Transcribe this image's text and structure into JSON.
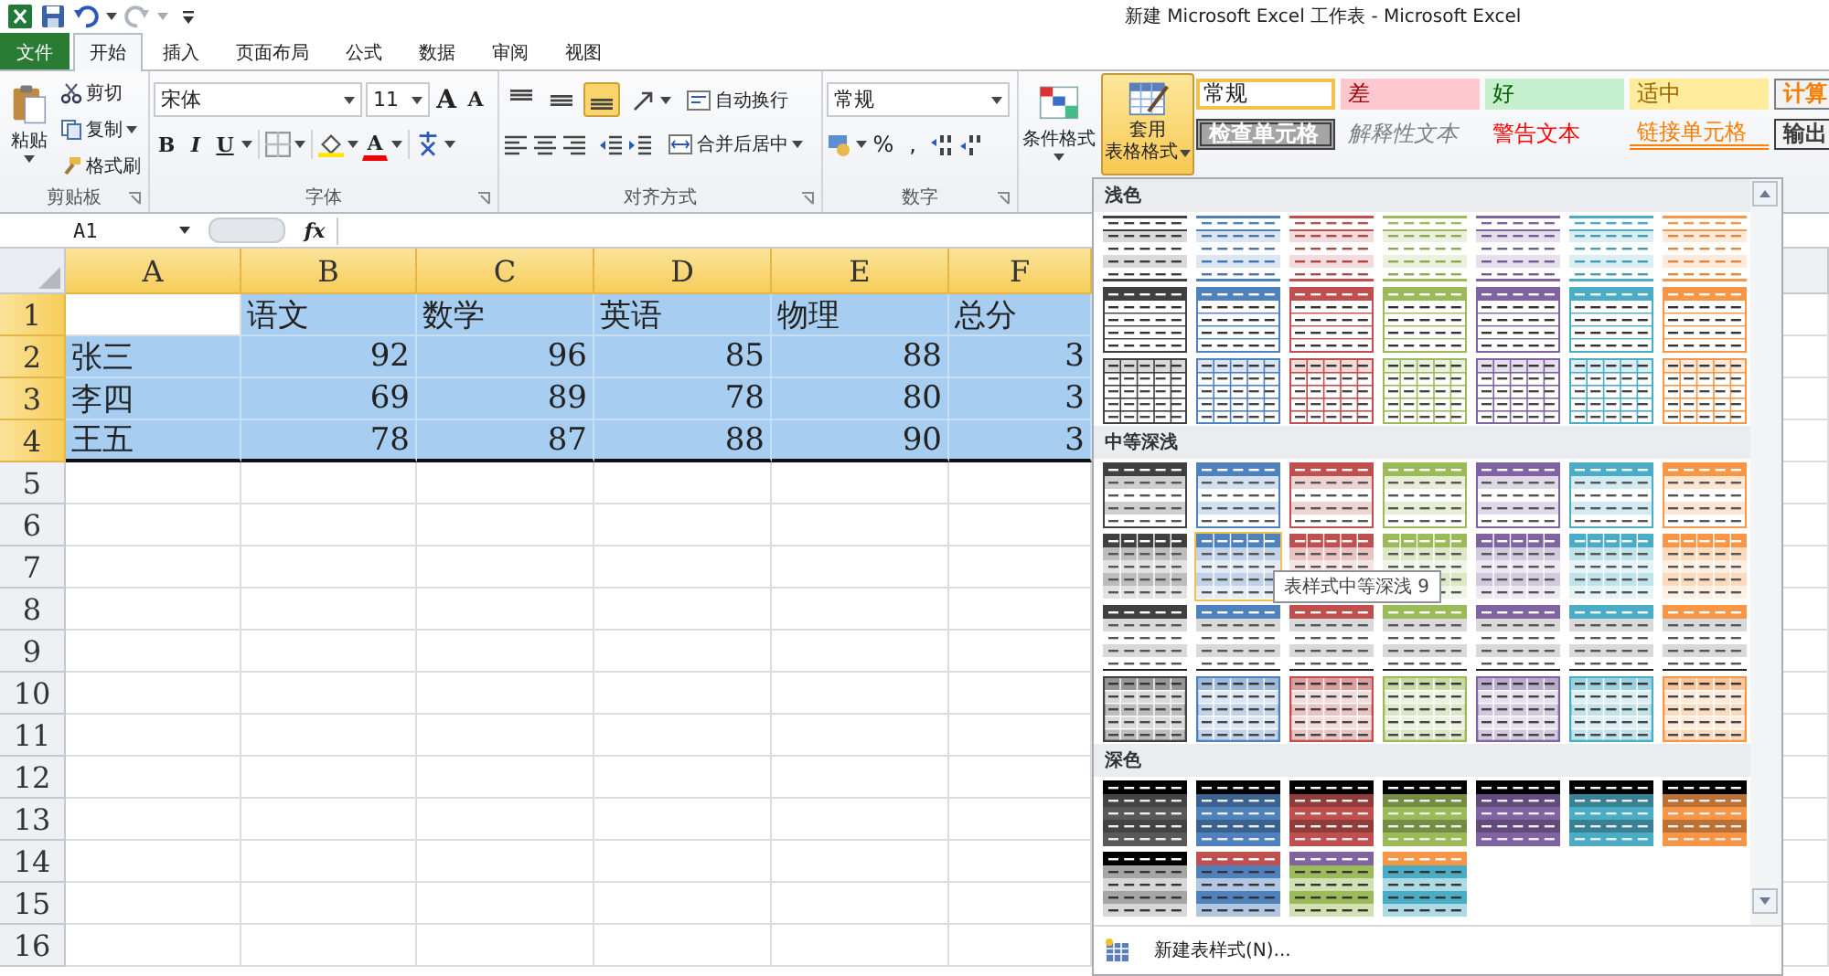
{
  "title_bar": {
    "title": "新建 Microsoft Excel 工作表 - Microsoft Excel"
  },
  "tabs": [
    {
      "label": "文件",
      "kind": "file",
      "selected": false
    },
    {
      "label": "开始",
      "kind": "tab",
      "selected": true
    },
    {
      "label": "插入",
      "kind": "tab",
      "selected": false
    },
    {
      "label": "页面布局",
      "kind": "tab",
      "selected": false
    },
    {
      "label": "公式",
      "kind": "tab",
      "selected": false
    },
    {
      "label": "数据",
      "kind": "tab",
      "selected": false
    },
    {
      "label": "审阅",
      "kind": "tab",
      "selected": false
    },
    {
      "label": "视图",
      "kind": "tab",
      "selected": false
    }
  ],
  "ribbon": {
    "clipboard": {
      "label": "剪贴板",
      "paste": "粘贴",
      "cut": "剪切",
      "copy": "复制",
      "painter": "格式刷"
    },
    "font": {
      "label": "字体",
      "font_name": "宋体",
      "font_size": "11",
      "grow": "A",
      "shrink": "A",
      "bold": "B",
      "italic": "I",
      "underline": "U",
      "color_letter": "A"
    },
    "alignment": {
      "label": "对齐方式",
      "wrap": "自动换行",
      "merge": "合并后居中",
      "vertical": [
        {
          "kind": "top",
          "selected": false
        },
        {
          "kind": "middle",
          "selected": false
        },
        {
          "kind": "bottom",
          "selected": true
        }
      ]
    },
    "number": {
      "label": "数字",
      "format": "常规",
      "percent": "%",
      "comma": ","
    },
    "conditional_format": "条件格式",
    "format_as_table": {
      "line1": "套用",
      "line2": "表格格式",
      "selected": true
    },
    "cell_styles": [
      {
        "label": "常规",
        "kind": "normal",
        "selected": true
      },
      {
        "label": "差",
        "kind": "bad",
        "selected": false
      },
      {
        "label": "好",
        "kind": "good",
        "selected": false
      },
      {
        "label": "适中",
        "kind": "neutral",
        "selected": false
      },
      {
        "label": "计算",
        "kind": "calculation",
        "selected": false
      },
      {
        "label": "检查单元格",
        "kind": "check",
        "selected": false
      },
      {
        "label": "解释性文本",
        "kind": "explanatory",
        "selected": false
      },
      {
        "label": "警告文本",
        "kind": "warning",
        "selected": false
      },
      {
        "label": "链接单元格",
        "kind": "linked",
        "selected": false
      },
      {
        "label": "输出",
        "kind": "output",
        "selected": false
      }
    ]
  },
  "formula_bar": {
    "name_box": "A1",
    "fx": "fx"
  },
  "sheet": {
    "columns": [
      {
        "label": "A",
        "selected": true
      },
      {
        "label": "B",
        "selected": true
      },
      {
        "label": "C",
        "selected": true
      },
      {
        "label": "D",
        "selected": true
      },
      {
        "label": "E",
        "selected": true
      },
      {
        "label": "F",
        "selected": true
      }
    ],
    "rows": [
      {
        "number": "1",
        "selected": true,
        "cells": [
          null,
          "语文",
          "数学",
          "英语",
          "物理",
          "总分"
        ]
      },
      {
        "number": "2",
        "selected": true,
        "cells": [
          "张三",
          "92",
          "96",
          "85",
          "88",
          "3"
        ]
      },
      {
        "number": "3",
        "selected": true,
        "cells": [
          "李四",
          "69",
          "89",
          "78",
          "80",
          "3"
        ]
      },
      {
        "number": "4",
        "selected": true,
        "cells": [
          "王五",
          "78",
          "87",
          "88",
          "90",
          "3"
        ]
      },
      {
        "number": "5",
        "selected": false
      },
      {
        "number": "6",
        "selected": false
      },
      {
        "number": "7",
        "selected": false
      },
      {
        "number": "8",
        "selected": false
      },
      {
        "number": "9",
        "selected": false
      },
      {
        "number": "10",
        "selected": false
      },
      {
        "number": "11",
        "selected": false
      },
      {
        "number": "12",
        "selected": false
      },
      {
        "number": "13",
        "selected": false
      },
      {
        "number": "14",
        "selected": false
      },
      {
        "number": "15",
        "selected": false
      },
      {
        "number": "16",
        "selected": false
      }
    ]
  },
  "gallery": {
    "sections": [
      {
        "title": "浅色",
        "rows": [
          {
            "kind": "light-banded",
            "styles": [
              {
                "color": "#404040",
                "selected": false
              },
              {
                "color": "#4f81bd",
                "selected": false
              },
              {
                "color": "#c0504d",
                "selected": false
              },
              {
                "color": "#9bbb59",
                "selected": false
              },
              {
                "color": "#8064a2",
                "selected": false
              },
              {
                "color": "#4bacc6",
                "selected": false
              },
              {
                "color": "#f79646",
                "selected": false
              }
            ]
          },
          {
            "kind": "light-header",
            "styles": [
              {
                "color": "#404040",
                "selected": false
              },
              {
                "color": "#4f81bd",
                "selected": false
              },
              {
                "color": "#c0504d",
                "selected": false
              },
              {
                "color": "#9bbb59",
                "selected": false
              },
              {
                "color": "#8064a2",
                "selected": false
              },
              {
                "color": "#4bacc6",
                "selected": false
              },
              {
                "color": "#f79646",
                "selected": false
              }
            ]
          },
          {
            "kind": "light-grid",
            "styles": [
              {
                "color": "#404040",
                "selected": false
              },
              {
                "color": "#4f81bd",
                "selected": false
              },
              {
                "color": "#c0504d",
                "selected": false
              },
              {
                "color": "#9bbb59",
                "selected": false
              },
              {
                "color": "#8064a2",
                "selected": false
              },
              {
                "color": "#4bacc6",
                "selected": false
              },
              {
                "color": "#f79646",
                "selected": false
              }
            ]
          }
        ]
      },
      {
        "title": "中等深浅",
        "rows": [
          {
            "kind": "medium-banded",
            "styles": [
              {
                "color": "#404040",
                "selected": false
              },
              {
                "color": "#4f81bd",
                "selected": false
              },
              {
                "color": "#c0504d",
                "selected": false
              },
              {
                "color": "#9bbb59",
                "selected": false
              },
              {
                "color": "#8064a2",
                "selected": false
              },
              {
                "color": "#4bacc6",
                "selected": false
              },
              {
                "color": "#f79646",
                "selected": false
              }
            ]
          },
          {
            "kind": "medium-header-grid",
            "styles": [
              {
                "color": "#404040",
                "selected": false
              },
              {
                "color": "#4f81bd",
                "selected": true
              },
              {
                "color": "#c0504d",
                "selected": false
              },
              {
                "color": "#9bbb59",
                "selected": false
              },
              {
                "color": "#8064a2",
                "selected": false
              },
              {
                "color": "#4bacc6",
                "selected": false
              },
              {
                "color": "#f79646",
                "selected": false
              }
            ]
          },
          {
            "kind": "medium-plain",
            "styles": [
              {
                "color": "#404040",
                "selected": false
              },
              {
                "color": "#4f81bd",
                "selected": false
              },
              {
                "color": "#c0504d",
                "selected": false
              },
              {
                "color": "#9bbb59",
                "selected": false
              },
              {
                "color": "#8064a2",
                "selected": false
              },
              {
                "color": "#4bacc6",
                "selected": false
              },
              {
                "color": "#f79646",
                "selected": false
              }
            ]
          },
          {
            "kind": "medium-grid",
            "styles": [
              {
                "color": "#404040",
                "selected": false
              },
              {
                "color": "#4f81bd",
                "selected": false
              },
              {
                "color": "#c0504d",
                "selected": false
              },
              {
                "color": "#9bbb59",
                "selected": false
              },
              {
                "color": "#8064a2",
                "selected": false
              },
              {
                "color": "#4bacc6",
                "selected": false
              },
              {
                "color": "#f79646",
                "selected": false
              }
            ]
          }
        ]
      },
      {
        "title": "深色",
        "rows": [
          {
            "kind": "dark-banded",
            "styles": [
              {
                "color": "#595959",
                "selected": false
              },
              {
                "color": "#4f81bd",
                "selected": false
              },
              {
                "color": "#c0504d",
                "selected": false
              },
              {
                "color": "#9bbb59",
                "selected": false
              },
              {
                "color": "#8064a2",
                "selected": false
              },
              {
                "color": "#4bacc6",
                "selected": false
              },
              {
                "color": "#f79646",
                "selected": false
              }
            ]
          },
          {
            "kind": "dark-split",
            "styles": [
              {
                "color": "#000000",
                "body": {
                  "color": "#a5a5a5"
                },
                "selected": false
              },
              {
                "color": "#c0504d",
                "body": {
                  "color": "#4f81bd"
                },
                "selected": false
              },
              {
                "color": "#8064a2",
                "body": {
                  "color": "#9bbb59"
                },
                "selected": false
              },
              {
                "color": "#f79646",
                "body": {
                  "color": "#4bacc6"
                },
                "selected": false
              }
            ]
          }
        ]
      }
    ],
    "tooltip": "表样式中等深浅 9",
    "new_style": "新建表样式(N)..."
  }
}
